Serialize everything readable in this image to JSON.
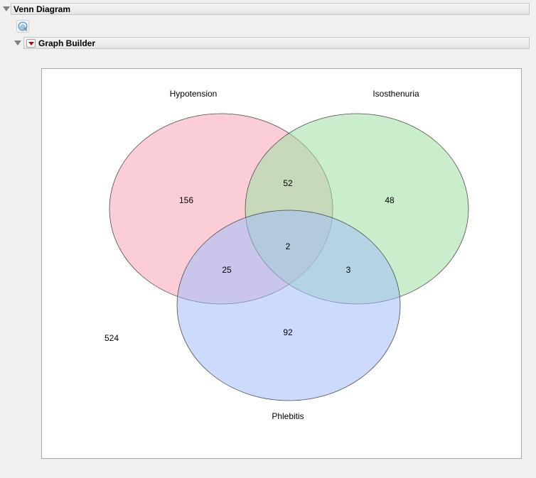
{
  "report": {
    "title": "Venn Diagram",
    "platform_title": "Graph Builder"
  },
  "icons": {
    "script": "script-icon",
    "disclosure": "disclosure-triangle-icon",
    "menu": "red-triangle-menu-icon"
  },
  "colors": {
    "set1": "#f7a6b6",
    "set2": "#9fe0a3",
    "set3": "#a3bdfa",
    "outline": "#4a4a4a"
  },
  "venn": {
    "sets": [
      {
        "label": "Hypotension"
      },
      {
        "label": "Isosthenuria"
      },
      {
        "label": "Phlebitis"
      }
    ],
    "regions": {
      "hypotension_only": "156",
      "isosthenuria_only": "48",
      "phlebitis_only": "92",
      "hypotension_isosthenuria": "52",
      "hypotension_phlebitis": "25",
      "isosthenuria_phlebitis": "3",
      "all_three": "2",
      "none": "524"
    }
  }
}
